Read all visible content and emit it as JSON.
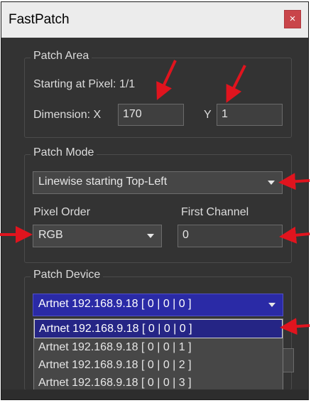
{
  "window": {
    "title": "FastPatch",
    "close_glyph": "×"
  },
  "patch_area": {
    "legend": "Patch Area",
    "starting_text": "Starting at Pixel: 1/1",
    "dimension_label": "Dimension: X",
    "x_value": "170",
    "y_label": "Y",
    "y_value": "1"
  },
  "patch_mode": {
    "legend": "Patch Mode",
    "mode_selected": "Linewise starting Top-Left",
    "pixel_order_label": "Pixel Order",
    "pixel_order_selected": "RGB",
    "first_channel_label": "First Channel",
    "first_channel_value": "0"
  },
  "patch_device": {
    "legend": "Patch Device",
    "selected": "Artnet 192.168.9.18 [ 0 | 0 | 0 ]",
    "options": [
      "Artnet 192.168.9.18 [ 0 | 0 | 0 ]",
      "Artnet 192.168.9.18 [ 0 | 0 | 1 ]",
      "Artnet 192.168.9.18 [ 0 | 0 | 2 ]",
      "Artnet 192.168.9.18 [ 0 | 0 | 3 ]"
    ]
  },
  "annotation": {
    "arrow_color": "#e0141e"
  }
}
